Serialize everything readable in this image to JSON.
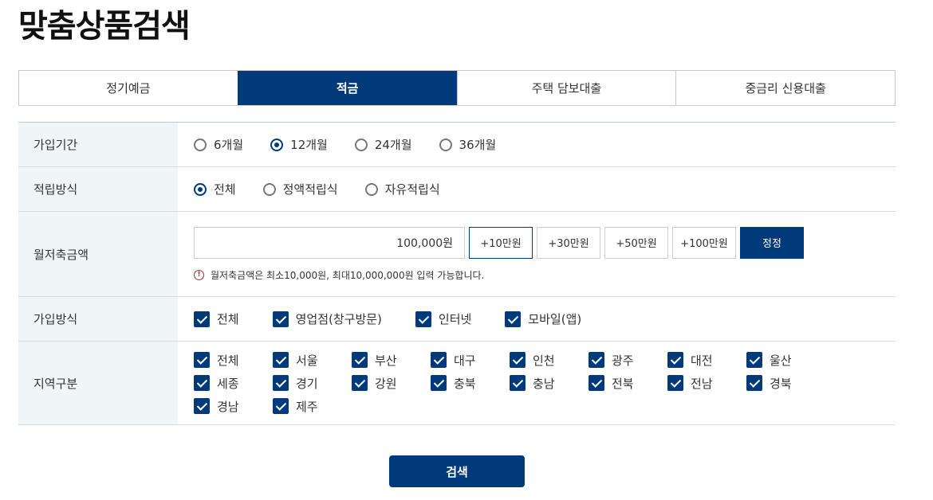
{
  "page_title": "맞춤상품검색",
  "tabs": [
    {
      "label": "정기예금",
      "active": false
    },
    {
      "label": "적금",
      "active": true
    },
    {
      "label": "주택 담보대출",
      "active": false
    },
    {
      "label": "중금리 신용대출",
      "active": false
    }
  ],
  "period": {
    "label": "가입기간",
    "options": [
      {
        "label": "6개월",
        "selected": false
      },
      {
        "label": "12개월",
        "selected": true
      },
      {
        "label": "24개월",
        "selected": false
      },
      {
        "label": "36개월",
        "selected": false
      }
    ]
  },
  "method": {
    "label": "적립방식",
    "options": [
      {
        "label": "전체",
        "selected": true
      },
      {
        "label": "정액적립식",
        "selected": false
      },
      {
        "label": "자유적립식",
        "selected": false
      }
    ]
  },
  "amount": {
    "label": "월저축금액",
    "value": "100,000원",
    "buttons": [
      "+10만원",
      "+30만원",
      "+50만원",
      "+100만원"
    ],
    "confirm_label": "정정",
    "hint": "월저축금액은 최소10,000원, 최대10,000,000원 입력 가능합니다.",
    "hint_icon": "warning-icon"
  },
  "join": {
    "label": "가입방식",
    "options": [
      "전체",
      "영업점(창구방문)",
      "인터넷",
      "모바일(앱)"
    ]
  },
  "region": {
    "label": "지역구분",
    "options": [
      "전체",
      "서울",
      "부산",
      "대구",
      "인천",
      "광주",
      "대전",
      "울산",
      "세종",
      "경기",
      "강원",
      "충북",
      "충남",
      "전북",
      "전남",
      "경북",
      "경남",
      "제주"
    ]
  },
  "search_label": "검색",
  "colors": {
    "primary": "#003a7a",
    "label_bg": "#f0f6f8",
    "warning": "#c0272d"
  }
}
